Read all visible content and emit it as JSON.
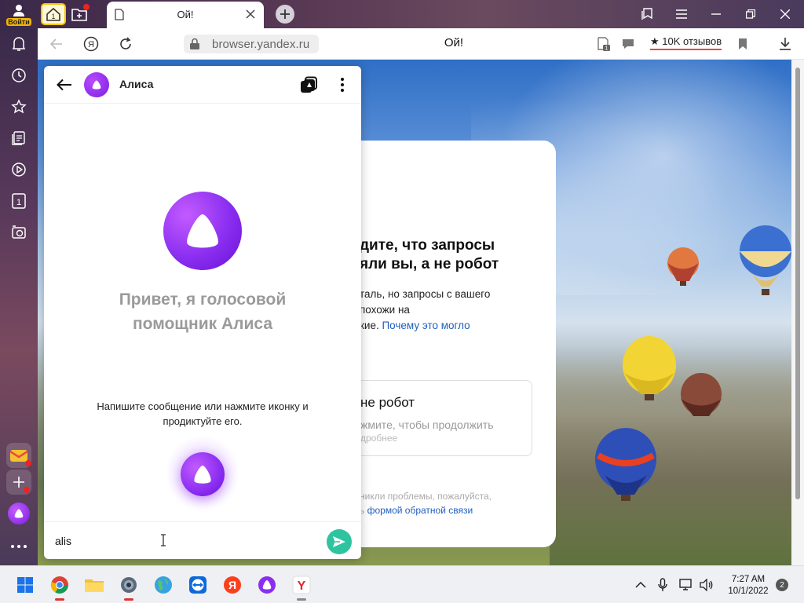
{
  "browser": {
    "account_label": "Войти",
    "tab_title": "Ой!",
    "url": "browser.yandex.ru",
    "page_title": "Ой!",
    "reviews_label": "10K отзывов"
  },
  "captcha": {
    "heading": "дите, что запросы\nяли вы, а не робот",
    "desc_text": "таль, но запросы с вашего\nпохожи на\nкие. ",
    "desc_link": "Почему это могло",
    "box_title": "не робот",
    "box_sub": "жмите, чтобы продолжить",
    "box_more": "дробнее",
    "footer_text": "никли проблемы, пожалуйста,\nь ",
    "footer_link": "формой обратной связи"
  },
  "alice": {
    "name": "Алиса",
    "greeting": "Привет, я голосовой помощник Алиса",
    "hint": "Напишите сообщение или нажмите иконку и продиктуйте его.",
    "input_value": "alis",
    "input_placeholder": ""
  },
  "taskbar": {
    "time": "7:27 AM",
    "date": "10/1/2022",
    "notification_count": "2"
  },
  "colors": {
    "alice_purple": "#8a2ef0",
    "send_green": "#2ec4a0",
    "link_blue": "#1f5fbf"
  }
}
